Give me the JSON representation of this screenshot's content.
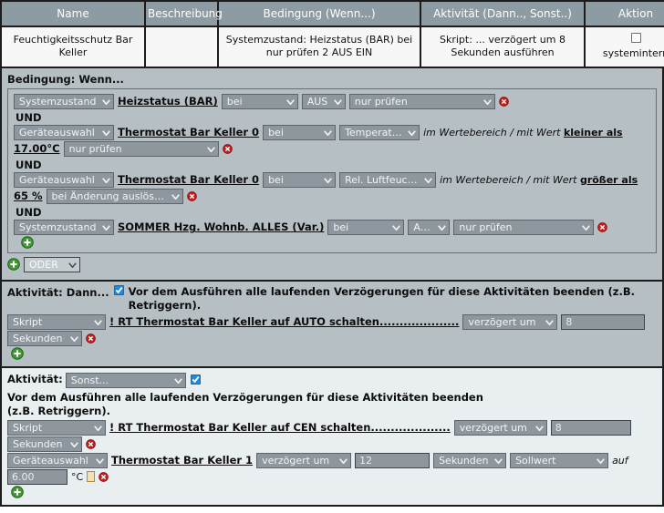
{
  "table": {
    "headers": [
      "Name",
      "Beschreibung",
      "Bedingung (Wenn...)",
      "Aktivität (Dann.., Sonst..)",
      "Aktion"
    ],
    "row": {
      "name": "Feuchtigkeitsschutz Bar Keller",
      "beschreibung": "",
      "bedingung": "Systemzustand: Heizstatus (BAR) bei nur prüfen 2 AUS EIN",
      "aktivitaet": "Skript: ... verzögert um 8 Sekunden ausführen",
      "aktion_label": "systemintern"
    }
  },
  "condition": {
    "title": "Bedingung: Wenn...",
    "and_label": "UND",
    "or_select": "ODER",
    "rows": [
      {
        "type_select": "Systemzustand",
        "target": "Heizstatus (BAR)",
        "op_select": "bei",
        "state_select": "AUS",
        "mode_select": "nur prüfen"
      },
      {
        "type_select": "Geräteauswahl",
        "target": "Thermostat Bar Keller 0",
        "op_select": "bei",
        "channel_select": "Temperatur",
        "range_text": "im Wertebereich / mit Wert",
        "range_compare": "kleiner als",
        "value": "17.00°C",
        "mode_select": "nur prüfen"
      },
      {
        "type_select": "Geräteauswahl",
        "target": "Thermostat Bar Keller 0",
        "op_select": "bei",
        "channel_select": "Rel. Luftfeuchte",
        "range_text": "im Wertebereich / mit Wert",
        "range_compare": "größer als",
        "value": "65 %",
        "mode_select": "bei Änderung auslösen"
      },
      {
        "type_select": "Systemzustand",
        "target": "SOMMER Hzg. Wohnb. ALLES (Var.)",
        "op_select": "bei",
        "state_select": "AUS",
        "mode_select": "nur prüfen"
      }
    ]
  },
  "activity_dann": {
    "title": "Aktivität: Dann...",
    "checkbox_label": "Vor dem Ausführen alle laufenden Verzögerungen für diese Aktivitäten beenden (z.B. Retriggern).",
    "checkbox_checked": true,
    "rows": [
      {
        "type_select": "Skript",
        "target": "! RT Thermostat Bar Keller auf AUTO schalten....................",
        "delay_select": "verzögert um",
        "delay_value": "8",
        "unit_select": "Sekunden"
      }
    ]
  },
  "activity_sonst": {
    "title": "Aktivität:",
    "type_select": "Sonst...",
    "checkbox_label": "Vor dem Ausführen alle laufenden Verzögerungen für diese Aktivitäten beenden (z.B. Retriggern).",
    "checkbox_checked": true,
    "rows": [
      {
        "type_select": "Skript",
        "target": "! RT Thermostat Bar Keller auf CEN schalten....................",
        "delay_select": "verzögert um",
        "delay_value": "8",
        "unit_select": "Sekunden"
      },
      {
        "type_select": "Geräteauswahl",
        "target": "Thermostat Bar Keller 1",
        "delay_select": "verzögert um",
        "delay_value": "12",
        "unit_select": "Sekunden",
        "param_select": "Sollwert",
        "auf_label": "auf",
        "value": "6.00",
        "value_unit": "°C"
      }
    ]
  },
  "icons": {
    "add": "add-circle-icon",
    "delete": "delete-circle-icon",
    "note": "note-icon",
    "chevron": "chevron-down-icon"
  },
  "colors": {
    "header_bg": "#8d9ba2",
    "panel_bg": "#b6bfc4",
    "panel_light_bg": "#e9eef1",
    "control_bg": "#8e979d",
    "checkbox_accent": "#1f8ae0",
    "add_green": "#3f9a32",
    "delete_red": "#c32020"
  }
}
